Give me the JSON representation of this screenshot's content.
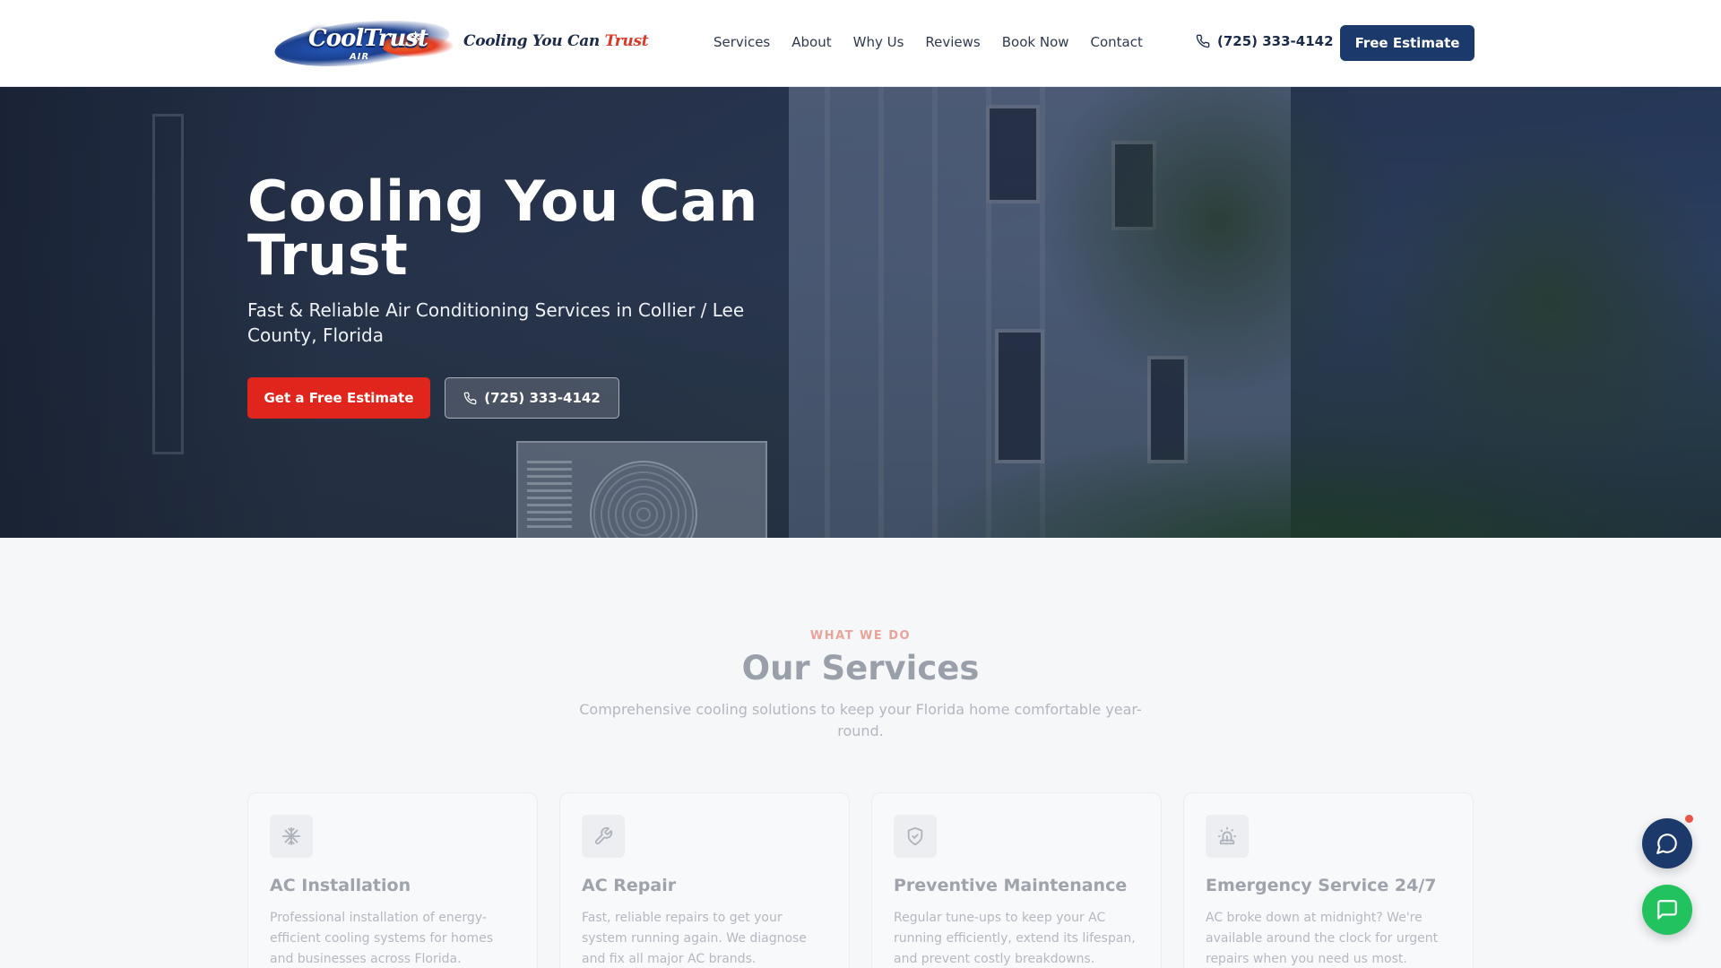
{
  "brand": {
    "logo_text": "CoolTrust",
    "logo_sub": "AIR",
    "tagline_part1": "Cooling You Can",
    "tagline_part2": "Trust"
  },
  "nav": {
    "items": [
      {
        "label": "Services"
      },
      {
        "label": "About"
      },
      {
        "label": "Why Us"
      },
      {
        "label": "Reviews"
      },
      {
        "label": "Book Now"
      },
      {
        "label": "Contact"
      }
    ],
    "phone": "(725) 333-4142",
    "cta_label": "Free Estimate"
  },
  "hero": {
    "title": "Cooling You Can Trust",
    "subtitle": "Fast & Reliable Air Conditioning Services in Collier / Lee County, Florida",
    "primary_button": "Get a Free Estimate",
    "phone_button": "(725) 333-4142"
  },
  "services": {
    "eyebrow": "WHAT WE DO",
    "title": "Our Services",
    "subtitle": "Comprehensive cooling solutions to keep your Florida home comfortable year-round.",
    "cards": [
      {
        "icon": "snowflake-icon",
        "title": "AC Installation",
        "text": "Professional installation of energy-efficient cooling systems for homes and businesses across Florida."
      },
      {
        "icon": "wrench-icon",
        "title": "AC Repair",
        "text": "Fast, reliable repairs to get your system running again. We diagnose and fix all major AC brands."
      },
      {
        "icon": "shield-check-icon",
        "title": "Preventive Maintenance",
        "text": "Regular tune-ups to keep your AC running efficiently, extend its lifespan, and prevent costly breakdowns."
      },
      {
        "icon": "siren-icon",
        "title": "Emergency Service 24/7",
        "text": "AC broke down at midnight? We're available around the clock for urgent repairs when you need us most."
      }
    ]
  },
  "colors": {
    "navy": "#1b3a6b",
    "red": "#e0261c",
    "green": "#22c35e"
  }
}
